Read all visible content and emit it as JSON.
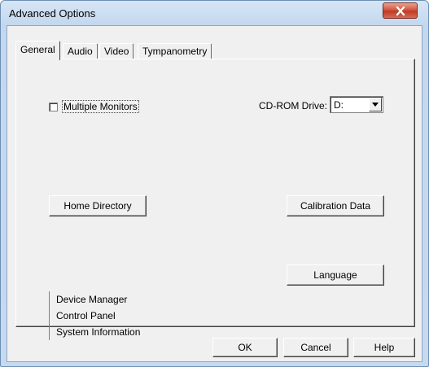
{
  "window": {
    "title": "Advanced Options"
  },
  "tabs": [
    {
      "label": "General"
    },
    {
      "label": "Audio"
    },
    {
      "label": "Video"
    },
    {
      "label": "Tympanometry"
    }
  ],
  "general": {
    "multiple_monitors": {
      "label": "Multiple Monitors",
      "checked": false
    },
    "cdrom": {
      "label": "CD-ROM Drive:",
      "value": "D:"
    },
    "home_directory_label": "Home Directory",
    "calibration_data_label": "Calibration Data",
    "language_label": "Language",
    "links": [
      "Device Manager",
      "Control Panel",
      "System Information"
    ]
  },
  "footer": {
    "ok_label": "OK",
    "cancel_label": "Cancel",
    "help_label": "Help"
  },
  "colors": {
    "title_bar": "#c3d7ee",
    "client_bg": "#f0f0f0",
    "close_button": "#c13b25"
  },
  "icons": {
    "close": "close-icon",
    "dropdown": "chevron-down-icon"
  }
}
